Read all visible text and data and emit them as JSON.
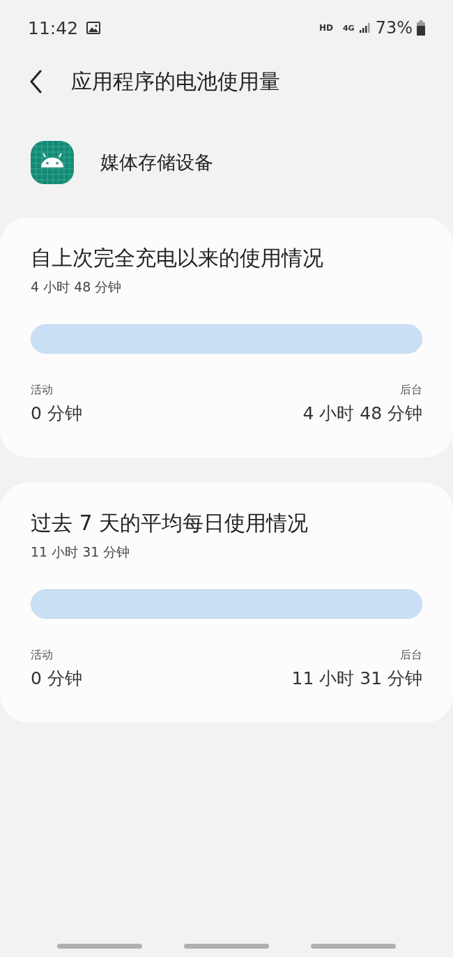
{
  "status_bar": {
    "time": "11:42",
    "hd": "HD",
    "network": "4G",
    "battery": "73%"
  },
  "header": {
    "title": "应用程序的电池使用量"
  },
  "app": {
    "name": "媒体存储设备"
  },
  "cards": [
    {
      "title": "自上次完全充电以来的使用情况",
      "total": "4 小时 48 分钟",
      "level": 1,
      "left_label": "活动",
      "left_value": "0 分钟",
      "right_label": "后台",
      "right_value": "4 小时 48 分钟"
    },
    {
      "title": "过去 7 天的平均每日使用情况",
      "total": "11 小时 31 分钟",
      "level": 1,
      "left_label": "活动",
      "left_value": "0 分钟",
      "right_label": "后台",
      "right_value": "11 小时 31 分钟"
    }
  ]
}
